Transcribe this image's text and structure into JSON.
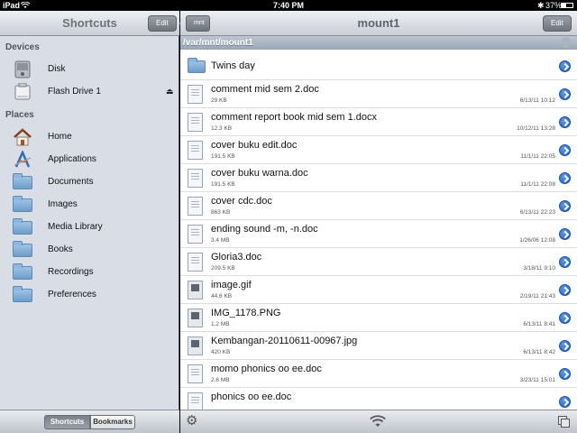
{
  "status": {
    "carrier": "iPad",
    "time": "7:40 PM",
    "battery": "37%"
  },
  "sidebar": {
    "title": "Shortcuts",
    "edit_label": "Edit",
    "sections": {
      "devices": "Devices",
      "places": "Places"
    },
    "devices": [
      {
        "label": "Disk",
        "icon": "disk-icon"
      },
      {
        "label": "Flash Drive 1",
        "icon": "flash-drive-icon"
      }
    ],
    "places": [
      {
        "label": "Home",
        "icon": "home-icon"
      },
      {
        "label": "Applications",
        "icon": "applications-icon"
      },
      {
        "label": "Documents",
        "icon": "documents-folder-icon"
      },
      {
        "label": "Images",
        "icon": "images-folder-icon"
      },
      {
        "label": "Media Library",
        "icon": "media-folder-icon"
      },
      {
        "label": "Books",
        "icon": "folder-icon"
      },
      {
        "label": "Recordings",
        "icon": "folder-icon"
      },
      {
        "label": "Preferences",
        "icon": "folder-icon"
      }
    ],
    "footer": {
      "shortcuts": "Shortcuts",
      "bookmarks": "Bookmarks"
    }
  },
  "main": {
    "back_label": "mnt",
    "title": "mount1",
    "edit_label": "Edit",
    "path": "/var/mnt/mount1",
    "items": [
      {
        "name": "Twins day",
        "type": "folder"
      },
      {
        "name": "comment mid sem 2.doc",
        "size": "29 KB",
        "date": "6/13/11 10:12",
        "type": "doc"
      },
      {
        "name": "comment report book mid sem 1.docx",
        "size": "12.3 KB",
        "date": "10/12/11 13:28",
        "type": "doc"
      },
      {
        "name": "cover buku edit.doc",
        "size": "191.5 KB",
        "date": "11/1/11 22:05",
        "type": "doc"
      },
      {
        "name": "cover buku warna.doc",
        "size": "191.5 KB",
        "date": "11/1/11 22:08",
        "type": "doc"
      },
      {
        "name": "cover cdc.doc",
        "size": "863 KB",
        "date": "6/13/11 22:23",
        "type": "doc"
      },
      {
        "name": "ending sound -m, -n.doc",
        "size": "3.4 MB",
        "date": "1/26/06 12:08",
        "type": "doc"
      },
      {
        "name": "Gloria3.doc",
        "size": "209.5 KB",
        "date": "3/18/11 9:10",
        "type": "doc"
      },
      {
        "name": "image.gif",
        "size": "44.6 KB",
        "date": "2/19/11 21:43",
        "type": "gif"
      },
      {
        "name": "IMG_1178.PNG",
        "size": "1.2 MB",
        "date": "6/13/11 8:41",
        "type": "png"
      },
      {
        "name": "Kembangan-20110611-00967.jpg",
        "size": "420 KB",
        "date": "6/13/11 8:42",
        "type": "jpg"
      },
      {
        "name": "momo phonics oo ee.doc",
        "size": "2.6 MB",
        "date": "3/23/11 15:01",
        "type": "doc"
      },
      {
        "name": "phonics oo ee.doc",
        "size": "",
        "date": "",
        "type": "doc"
      }
    ]
  },
  "colors": {
    "accent_blue": "#2d6fd0",
    "sidebar_bg": "#d9dde6"
  }
}
